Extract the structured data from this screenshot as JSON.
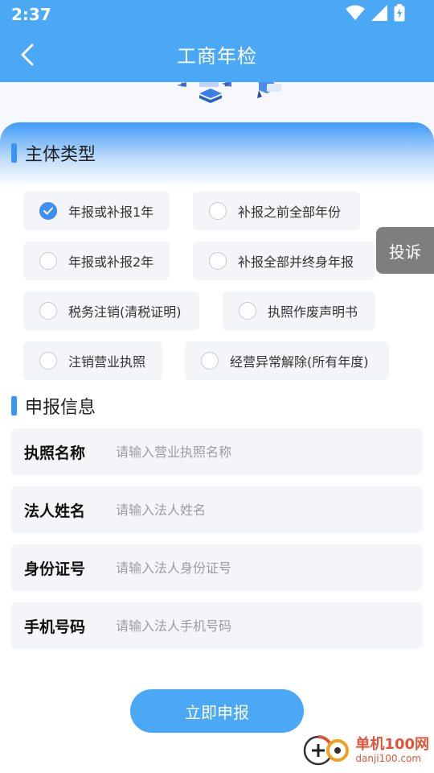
{
  "status": {
    "time": "2:37"
  },
  "header": {
    "title": "工商年检"
  },
  "section_type": {
    "title": "主体类型",
    "options": [
      {
        "label": "年报或补报1年",
        "checked": true
      },
      {
        "label": "补报之前全部年份",
        "checked": false
      },
      {
        "label": "年报或补报2年",
        "checked": false
      },
      {
        "label": "补报全部并终身年报",
        "checked": false
      },
      {
        "label": "税务注销(清税证明)",
        "checked": false
      },
      {
        "label": "执照作废声明书",
        "checked": false
      },
      {
        "label": "注销营业执照",
        "checked": false
      },
      {
        "label": "经营异常解除(所有年度)",
        "checked": false
      }
    ]
  },
  "complain": {
    "label": "投诉"
  },
  "section_info": {
    "title": "申报信息",
    "fields": [
      {
        "label": "执照名称",
        "placeholder": "请输入营业执照名称",
        "value": ""
      },
      {
        "label": "法人姓名",
        "placeholder": "请输入法人姓名",
        "value": ""
      },
      {
        "label": "身份证号",
        "placeholder": "请输入法人身份证号",
        "value": ""
      },
      {
        "label": "手机号码",
        "placeholder": "请输入法人手机号码",
        "value": ""
      }
    ]
  },
  "submit": {
    "label": "立即申报"
  },
  "watermark": {
    "name": "单机100网",
    "url": "danji100.com"
  },
  "colors": {
    "primary": "#4aa8f5",
    "accent": "#3a95f4",
    "option_bg": "#f4f5f8",
    "complain_bg": "#7e7e7e"
  }
}
